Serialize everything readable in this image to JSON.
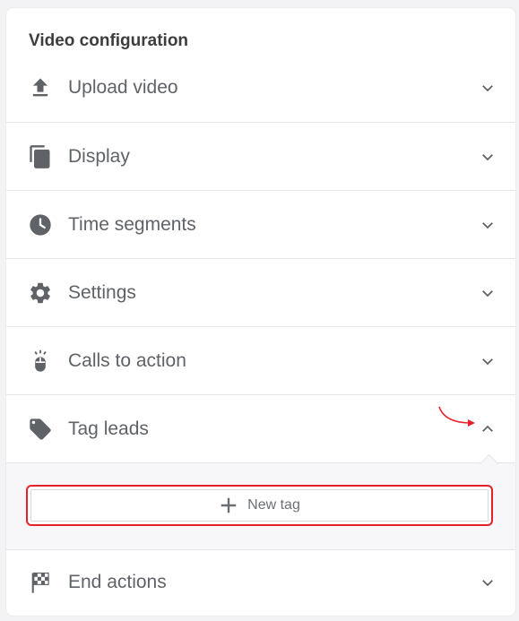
{
  "panel": {
    "title": "Video configuration"
  },
  "sections": [
    {
      "id": "upload",
      "label": "Upload video",
      "icon": "upload-icon",
      "expanded": false
    },
    {
      "id": "display",
      "label": "Display",
      "icon": "copy-icon",
      "expanded": false
    },
    {
      "id": "time",
      "label": "Time segments",
      "icon": "clock-icon",
      "expanded": false
    },
    {
      "id": "settings",
      "label": "Settings",
      "icon": "gear-icon",
      "expanded": false
    },
    {
      "id": "cta",
      "label": "Calls to action",
      "icon": "mouse-click-icon",
      "expanded": false
    },
    {
      "id": "tag",
      "label": "Tag leads",
      "icon": "tag-icon",
      "expanded": true
    },
    {
      "id": "end",
      "label": "End actions",
      "icon": "checkered-flag-icon",
      "expanded": false
    }
  ],
  "tag_leads": {
    "new_tag_label": "New tag"
  },
  "colors": {
    "icon": "#5f6368",
    "text": "#5f6368",
    "highlight": "#e8202a",
    "divider": "#e6e6e9"
  }
}
